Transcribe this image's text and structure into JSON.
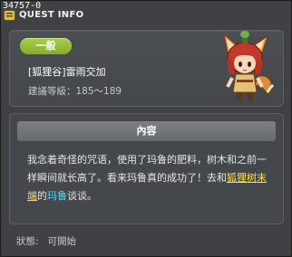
{
  "window": {
    "id": "34757-0",
    "title": "QUEST INFO"
  },
  "quest": {
    "category_tag": "一般",
    "name": "[狐狸谷]雷雨交加",
    "level_label": "建議等級：",
    "level_range": "185～189"
  },
  "content": {
    "header": "內容",
    "text_part1": "我念着奇怪的咒语，使用了玛鲁的肥料，树木和之前一样瞬间就长高了。看来玛鲁真的成功了！去和",
    "highlight_location": "狐狸树末端",
    "text_part2": "的",
    "highlight_npc": "玛鲁",
    "text_part3": "谈谈。"
  },
  "status": {
    "label": "狀態:",
    "value": "可開始"
  },
  "colors": {
    "tag_green": "#9bc33e",
    "highlight_yellow": "#ffe33c",
    "highlight_cyan": "#48e4ff"
  }
}
